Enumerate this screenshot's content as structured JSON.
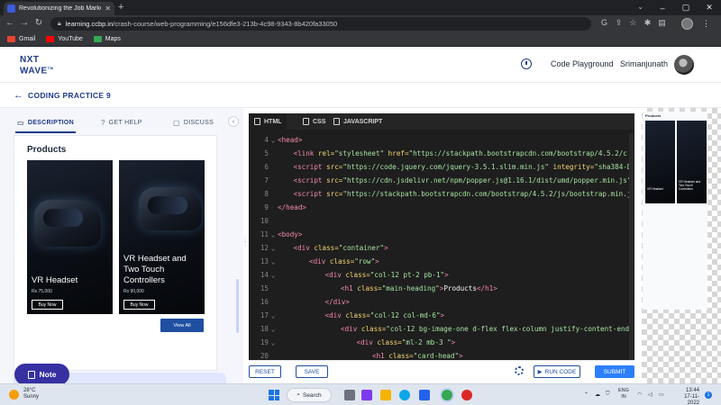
{
  "browser": {
    "tab_title": "Revolutionizing the Job Market |",
    "url_domain": "learning.ccbp.in",
    "url_path": "/crash-course/web-programming/e156dfe3-213b-4c98-9343-8b420fa33050",
    "bookmarks": [
      {
        "label": "Gmail",
        "color": "#ea4335"
      },
      {
        "label": "YouTube",
        "color": "#ff0000"
      },
      {
        "label": "Maps",
        "color": "#34a853"
      }
    ]
  },
  "header": {
    "logo_line1": "NXT",
    "logo_line2": "WAVE",
    "logo_tm": "TM",
    "playground_link": "Code Playground",
    "username": "Srimanjunath"
  },
  "title_row": {
    "title": "CODING PRACTICE 9"
  },
  "left_panel": {
    "tabs": [
      {
        "label": "DESCRIPTION",
        "active": true
      },
      {
        "label": "GET HELP",
        "active": false
      },
      {
        "label": "DISCUSS",
        "active": false
      }
    ],
    "heading": "Products",
    "products": [
      {
        "name": "VR Headset",
        "price": "Rs 75,000",
        "button": "Buy Now"
      },
      {
        "name": "VR Headset and Two Touch Controllers",
        "price": "Rs 90,000",
        "button": "Buy Now"
      }
    ],
    "view_all": "View All",
    "note_button": "Note"
  },
  "editor": {
    "tabs": [
      {
        "label": "HTML",
        "active": true
      },
      {
        "label": "CSS",
        "active": false
      },
      {
        "label": "JAVASCRIPT",
        "active": false
      }
    ],
    "lines": [
      {
        "n": "4",
        "fold": "⌄",
        "indent": 0,
        "parts": [
          [
            "t-tag",
            "<head>"
          ]
        ]
      },
      {
        "n": "5",
        "fold": "",
        "indent": 1,
        "parts": [
          [
            "t-tag",
            "<link "
          ],
          [
            "t-attr",
            "rel="
          ],
          [
            "t-str",
            "\"stylesheet\" "
          ],
          [
            "t-attr",
            "href="
          ],
          [
            "t-str",
            "\"https://stackpath.bootstrapcdn.com/bootstrap/4.5.2/c"
          ]
        ]
      },
      {
        "n": "6",
        "fold": "",
        "indent": 1,
        "parts": [
          [
            "t-tag",
            "<script "
          ],
          [
            "t-attr",
            "src="
          ],
          [
            "t-str",
            "\"https://code.jquery.com/jquery-3.5.1.slim.min.js\" "
          ],
          [
            "t-attr",
            "integrity="
          ],
          [
            "t-str",
            "\"sha384-D"
          ]
        ]
      },
      {
        "n": "7",
        "fold": "",
        "indent": 1,
        "parts": [
          [
            "t-tag",
            "<script "
          ],
          [
            "t-attr",
            "src="
          ],
          [
            "t-str",
            "\"https://cdn.jsdelivr.net/npm/popper.js@1.16.1/dist/umd/popper.min.js\""
          ]
        ]
      },
      {
        "n": "8",
        "fold": "",
        "indent": 1,
        "parts": [
          [
            "t-tag",
            "<script "
          ],
          [
            "t-attr",
            "src="
          ],
          [
            "t-str",
            "\"https://stackpath.bootstrapcdn.com/bootstrap/4.5.2/js/bootstrap.min.j"
          ]
        ]
      },
      {
        "n": "9",
        "fold": "",
        "indent": 0,
        "parts": [
          [
            "t-tag",
            "</head>"
          ]
        ]
      },
      {
        "n": "10",
        "fold": "",
        "indent": 0,
        "parts": []
      },
      {
        "n": "11",
        "fold": "⌄",
        "indent": 0,
        "parts": [
          [
            "t-tag",
            "<body>"
          ]
        ]
      },
      {
        "n": "12",
        "fold": "⌄",
        "indent": 1,
        "parts": [
          [
            "t-tag",
            "<div "
          ],
          [
            "t-attr",
            "class="
          ],
          [
            "t-str",
            "\"container\""
          ],
          [
            "t-tag",
            ">"
          ]
        ]
      },
      {
        "n": "13",
        "fold": "⌄",
        "indent": 2,
        "parts": [
          [
            "t-tag",
            "<div "
          ],
          [
            "t-attr",
            "class="
          ],
          [
            "t-str",
            "\"row\""
          ],
          [
            "t-tag",
            ">"
          ]
        ]
      },
      {
        "n": "14",
        "fold": "⌄",
        "indent": 3,
        "parts": [
          [
            "t-tag",
            "<div "
          ],
          [
            "t-attr",
            "class="
          ],
          [
            "t-str",
            "\"col-12 pt-2 pb-1\""
          ],
          [
            "t-tag",
            ">"
          ]
        ]
      },
      {
        "n": "15",
        "fold": "",
        "indent": 4,
        "parts": [
          [
            "t-tag",
            "<h1 "
          ],
          [
            "t-attr",
            "class="
          ],
          [
            "t-str",
            "\"main-heading\""
          ],
          [
            "t-tag",
            ">"
          ],
          [
            "t-text",
            "Products"
          ],
          [
            "t-tag",
            "</h1>"
          ]
        ]
      },
      {
        "n": "16",
        "fold": "",
        "indent": 3,
        "parts": [
          [
            "t-tag",
            "</div>"
          ]
        ]
      },
      {
        "n": "17",
        "fold": "⌄",
        "indent": 3,
        "parts": [
          [
            "t-tag",
            "<div "
          ],
          [
            "t-attr",
            "class="
          ],
          [
            "t-str",
            "\"col-12 col-md-6\""
          ],
          [
            "t-tag",
            ">"
          ]
        ]
      },
      {
        "n": "18",
        "fold": "⌄",
        "indent": 4,
        "parts": [
          [
            "t-tag",
            "<div "
          ],
          [
            "t-attr",
            "class="
          ],
          [
            "t-str",
            "\"col-12 bg-image-one d-flex flex-column justify-content-end"
          ]
        ]
      },
      {
        "n": "19",
        "fold": "⌄",
        "indent": 5,
        "parts": [
          [
            "t-tag",
            "<div "
          ],
          [
            "t-attr",
            "class="
          ],
          [
            "t-str",
            "\"ml-2 mb-3 \""
          ],
          [
            "t-tag",
            ">"
          ]
        ]
      },
      {
        "n": "20",
        "fold": "",
        "indent": 6,
        "parts": [
          [
            "t-tag",
            "<h1 "
          ],
          [
            "t-attr",
            "class="
          ],
          [
            "t-str",
            "\"card-head\""
          ],
          [
            "t-tag",
            ">"
          ]
        ]
      }
    ],
    "buttons": {
      "reset": "RESET",
      "save": "SAVE",
      "run_code": "RUN CODE",
      "submit": "SUBMIT"
    }
  },
  "preview": {
    "title": "Products",
    "products": [
      "VR Headset",
      "VR Headset and Two Touch Controllers"
    ]
  },
  "taskbar": {
    "temperature": "28°C",
    "condition": "Sunny",
    "search": "Search",
    "lang1": "ENG",
    "lang2": "IN",
    "time": "13:44",
    "date": "17-11-2022",
    "notifications": "1"
  }
}
